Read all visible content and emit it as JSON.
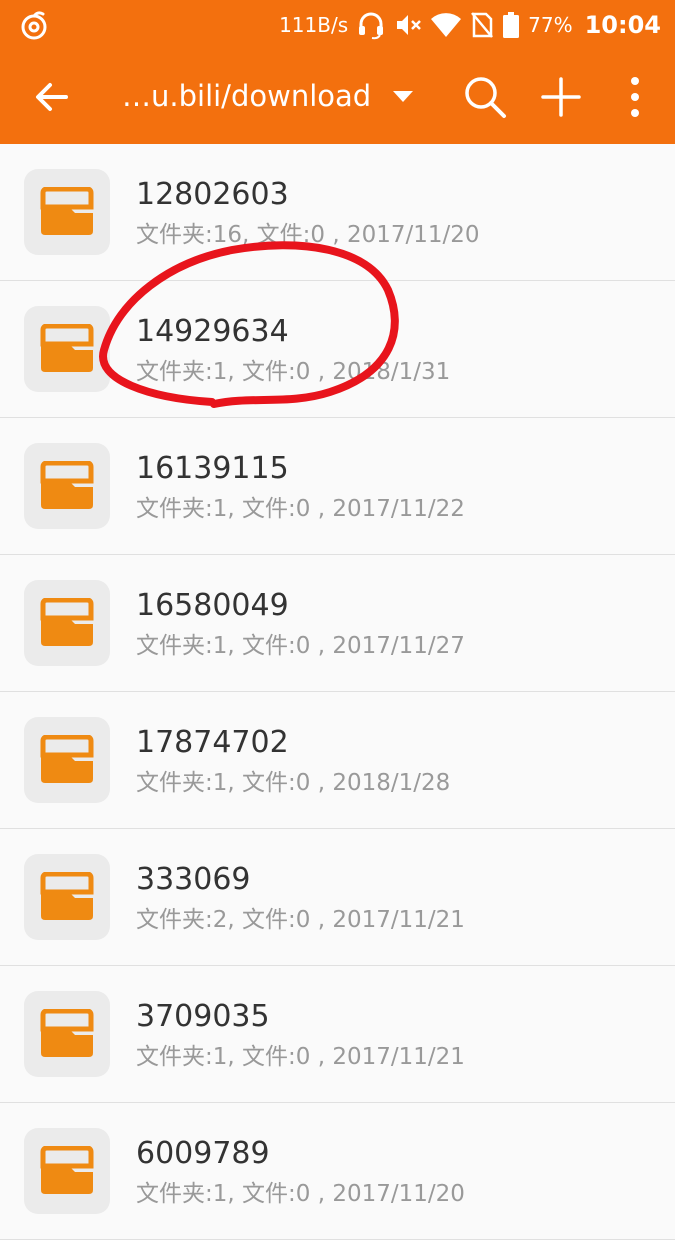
{
  "status_bar": {
    "app_icon": "netease-music-icon",
    "speed": "111B/s",
    "headset_icon": "headset-icon",
    "mute_icon": "mute-icon",
    "wifi_icon": "wifi-icon",
    "sim_icon": "no-sim-icon",
    "battery_icon": "battery-icon",
    "battery_percent": "77%",
    "time": "10:04"
  },
  "app_bar": {
    "path": "…u.bili/download"
  },
  "colors": {
    "accent": "#f3700e",
    "folder": "#ef8a12",
    "annotation": "#e8141c"
  },
  "files": [
    {
      "name": "12802603",
      "meta": "文件夹:16, 文件:0 , 2017/11/20"
    },
    {
      "name": "14929634",
      "meta": "文件夹:1, 文件:0 , 2018/1/31"
    },
    {
      "name": "16139115",
      "meta": "文件夹:1, 文件:0 , 2017/11/22"
    },
    {
      "name": "16580049",
      "meta": "文件夹:1, 文件:0 , 2017/11/27"
    },
    {
      "name": "17874702",
      "meta": "文件夹:1, 文件:0 , 2018/1/28"
    },
    {
      "name": "333069",
      "meta": "文件夹:2, 文件:0 , 2017/11/21"
    },
    {
      "name": "3709035",
      "meta": "文件夹:1, 文件:0 , 2017/11/21"
    },
    {
      "name": "6009789",
      "meta": "文件夹:1, 文件:0 , 2017/11/20"
    }
  ]
}
